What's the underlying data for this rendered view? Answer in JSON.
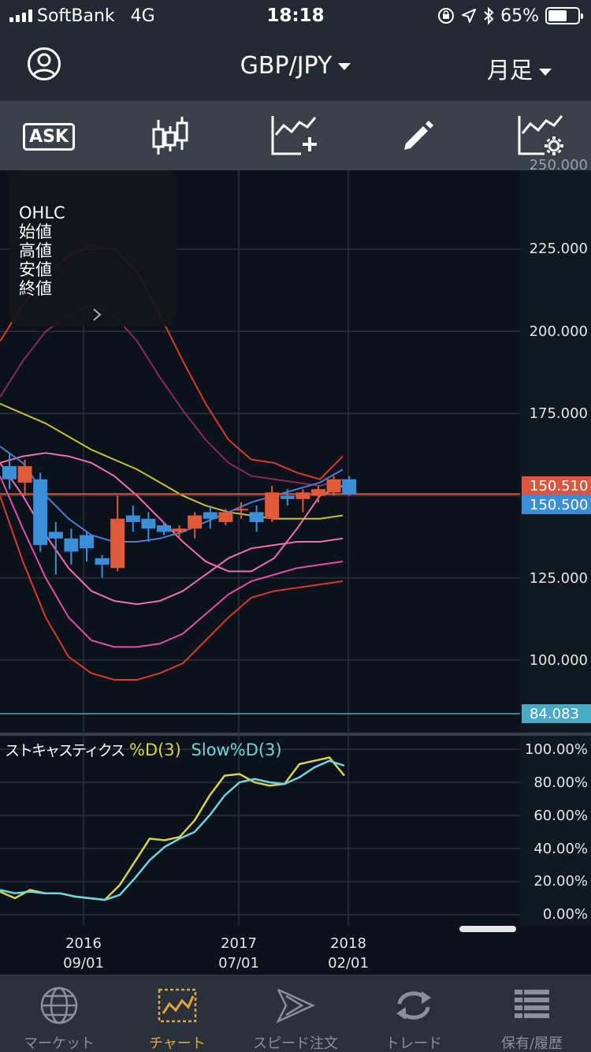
{
  "status_bar": {
    "carrier": "SoftBank",
    "network": "4G",
    "time": "18:18",
    "battery": "65%",
    "battery_level": 0.65
  },
  "nav": {
    "title": "GBP/JPY",
    "period": "月足",
    "profile_icon": "person-icon"
  },
  "toolbar": {
    "ask_label": "ASK",
    "tools": [
      "ask-icon",
      "candlestick-icon",
      "add-indicator-icon",
      "pencil-icon",
      "indicator-settings-icon"
    ]
  },
  "ohlc_panel": {
    "lines": [
      "OHLC",
      "始値",
      "高値",
      "安値",
      "終値"
    ]
  },
  "price_axis": {
    "labels": [
      "225.000",
      "200.000",
      "175.000",
      "125.000",
      "100.000"
    ],
    "top_partial": "250.000"
  },
  "price_tags": {
    "bid": "150.510",
    "ask": "150.500",
    "low_line": "84.083"
  },
  "stochastics": {
    "title": "ストキャスティクス",
    "series_d": "%D(3)",
    "series_slow": "Slow%D(3)",
    "axis": [
      "100.00%",
      "80.00%",
      "60.00%",
      "40.00%",
      "20.00%",
      "0.00%"
    ]
  },
  "x_axis": [
    {
      "year": "2016",
      "date": "09/01"
    },
    {
      "year": "2017",
      "date": "07/01"
    },
    {
      "year": "2018",
      "date": "02/01"
    }
  ],
  "tabs": [
    {
      "label": "マーケット",
      "icon": "globe-icon"
    },
    {
      "label": "チャート",
      "icon": "chart-icon"
    },
    {
      "label": "スピード注文",
      "icon": "speed-order-icon"
    },
    {
      "label": "トレード",
      "icon": "trade-icon"
    },
    {
      "label": "保有/履歴",
      "icon": "history-icon"
    }
  ],
  "colors": {
    "accent": "#e2a640",
    "up": "#e05a3a",
    "down": "#3a8fd8",
    "bid_tag": "#d9573e",
    "ask_tag": "#3a8fd8",
    "low_tag": "#4aa9c4"
  },
  "chart_data": [
    {
      "type": "candlestick",
      "title": "GBP/JPY",
      "ylim": [
        84,
        250
      ],
      "candles": [
        {
          "o": 159,
          "h": 163,
          "l": 152,
          "c": 155
        },
        {
          "o": 154,
          "h": 161,
          "l": 150,
          "c": 159
        },
        {
          "o": 155,
          "h": 157,
          "l": 133,
          "c": 135
        },
        {
          "o": 139,
          "h": 142,
          "l": 126,
          "c": 137
        },
        {
          "o": 137,
          "h": 140,
          "l": 129,
          "c": 133
        },
        {
          "o": 138,
          "h": 139,
          "l": 130,
          "c": 134
        },
        {
          "o": 131,
          "h": 132,
          "l": 125,
          "c": 129
        },
        {
          "o": 128,
          "h": 150,
          "l": 127,
          "c": 143
        },
        {
          "o": 144,
          "h": 147,
          "l": 139,
          "c": 142
        },
        {
          "o": 143,
          "h": 145,
          "l": 136,
          "c": 140
        },
        {
          "o": 141,
          "h": 142,
          "l": 138,
          "c": 139
        },
        {
          "o": 139,
          "h": 141,
          "l": 137,
          "c": 140
        },
        {
          "o": 140,
          "h": 145,
          "l": 137,
          "c": 144
        },
        {
          "o": 145,
          "h": 147,
          "l": 140,
          "c": 143
        },
        {
          "o": 142,
          "h": 146,
          "l": 141,
          "c": 145
        },
        {
          "o": 146,
          "h": 148,
          "l": 143,
          "c": 146
        },
        {
          "o": 145,
          "h": 147,
          "l": 139,
          "c": 142
        },
        {
          "o": 143,
          "h": 153,
          "l": 142,
          "c": 151
        },
        {
          "o": 150,
          "h": 152,
          "l": 147,
          "c": 149
        },
        {
          "o": 149,
          "h": 152,
          "l": 145,
          "c": 151
        },
        {
          "o": 150,
          "h": 153,
          "l": 148,
          "c": 152
        },
        {
          "o": 151,
          "h": 156,
          "l": 150,
          "c": 155
        },
        {
          "o": 155,
          "h": 156,
          "l": 150,
          "c": 150.51
        }
      ],
      "bands": {
        "red_upper": [
          197,
          208,
          217,
          223,
          226,
          225,
          218,
          205,
          191,
          178,
          167,
          161,
          160,
          157,
          155,
          162
        ],
        "magenta_upper": [
          164,
          165,
          166,
          165,
          163,
          159,
          152,
          143,
          135,
          128,
          121,
          117,
          115,
          114,
          150,
          152
        ]
      }
    },
    {
      "type": "line",
      "title": "ストキャスティクス",
      "ylim": [
        0,
        100
      ],
      "series": [
        {
          "name": "%D(3)",
          "values": [
            14,
            10,
            15,
            13,
            13,
            11,
            10,
            9,
            18,
            32,
            46,
            45,
            47,
            57,
            72,
            84,
            85,
            80,
            78,
            79,
            91,
            93,
            95,
            84
          ]
        },
        {
          "name": "Slow%D(3)",
          "values": [
            15,
            13,
            14,
            13,
            13,
            11,
            10,
            9,
            12,
            22,
            33,
            41,
            46,
            50,
            60,
            72,
            80,
            82,
            80,
            79,
            83,
            89,
            93,
            90
          ]
        }
      ]
    }
  ]
}
